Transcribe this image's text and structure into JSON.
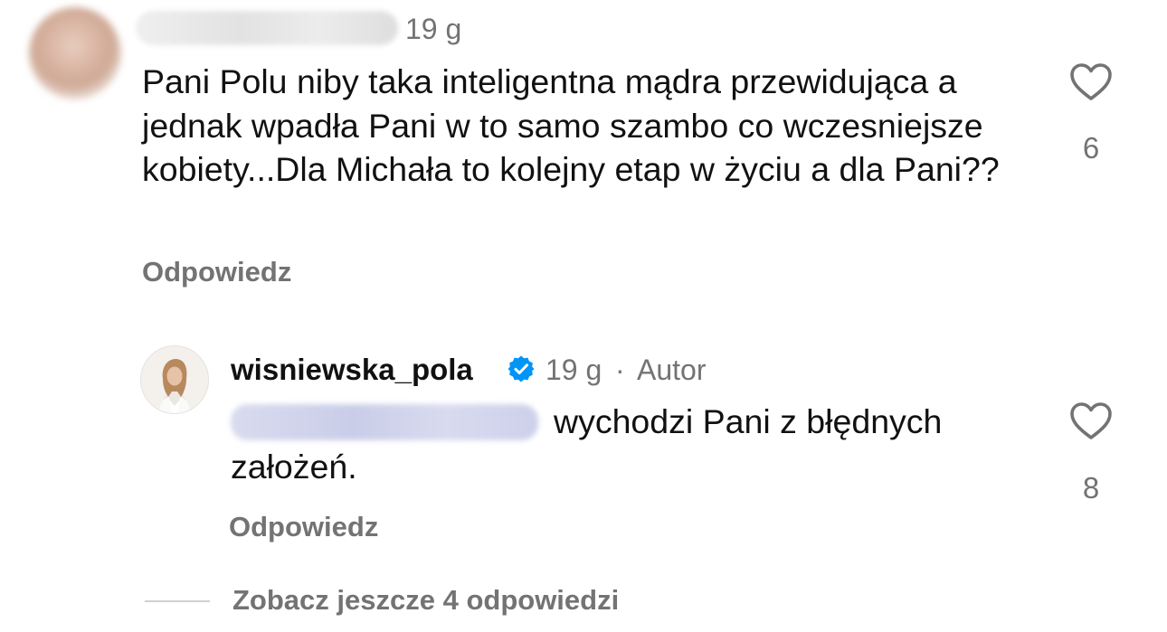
{
  "comment": {
    "author_hidden": true,
    "time": "19 g",
    "text": "Pani Polu niby taka inteligentna mądra przewidująca a jednak wpadła Pani w to samo szambo co wczesniejsze kobiety...Dla Michała to kolejny etap w życiu a dla Pani??",
    "reply_label": "Odpowiedz",
    "likes": "6",
    "like_icon": "heart-outline-icon"
  },
  "reply": {
    "author": "wisniewska_pola",
    "verified_icon": "verified-badge-icon",
    "time": "19 g",
    "separator": "·",
    "author_badge": "Autor",
    "mention_hidden": true,
    "text_line1": "wychodzi Pani z błędnych",
    "text_line2": "założeń.",
    "reply_label": "Odpowiedz",
    "likes": "8",
    "like_icon": "heart-outline-icon"
  },
  "more_replies": {
    "label": "Zobacz jeszcze 4 odpowiedzi"
  },
  "colors": {
    "text": "#111111",
    "secondary": "#737373",
    "verified": "#0095f6",
    "divider": "#d0d0d0"
  }
}
